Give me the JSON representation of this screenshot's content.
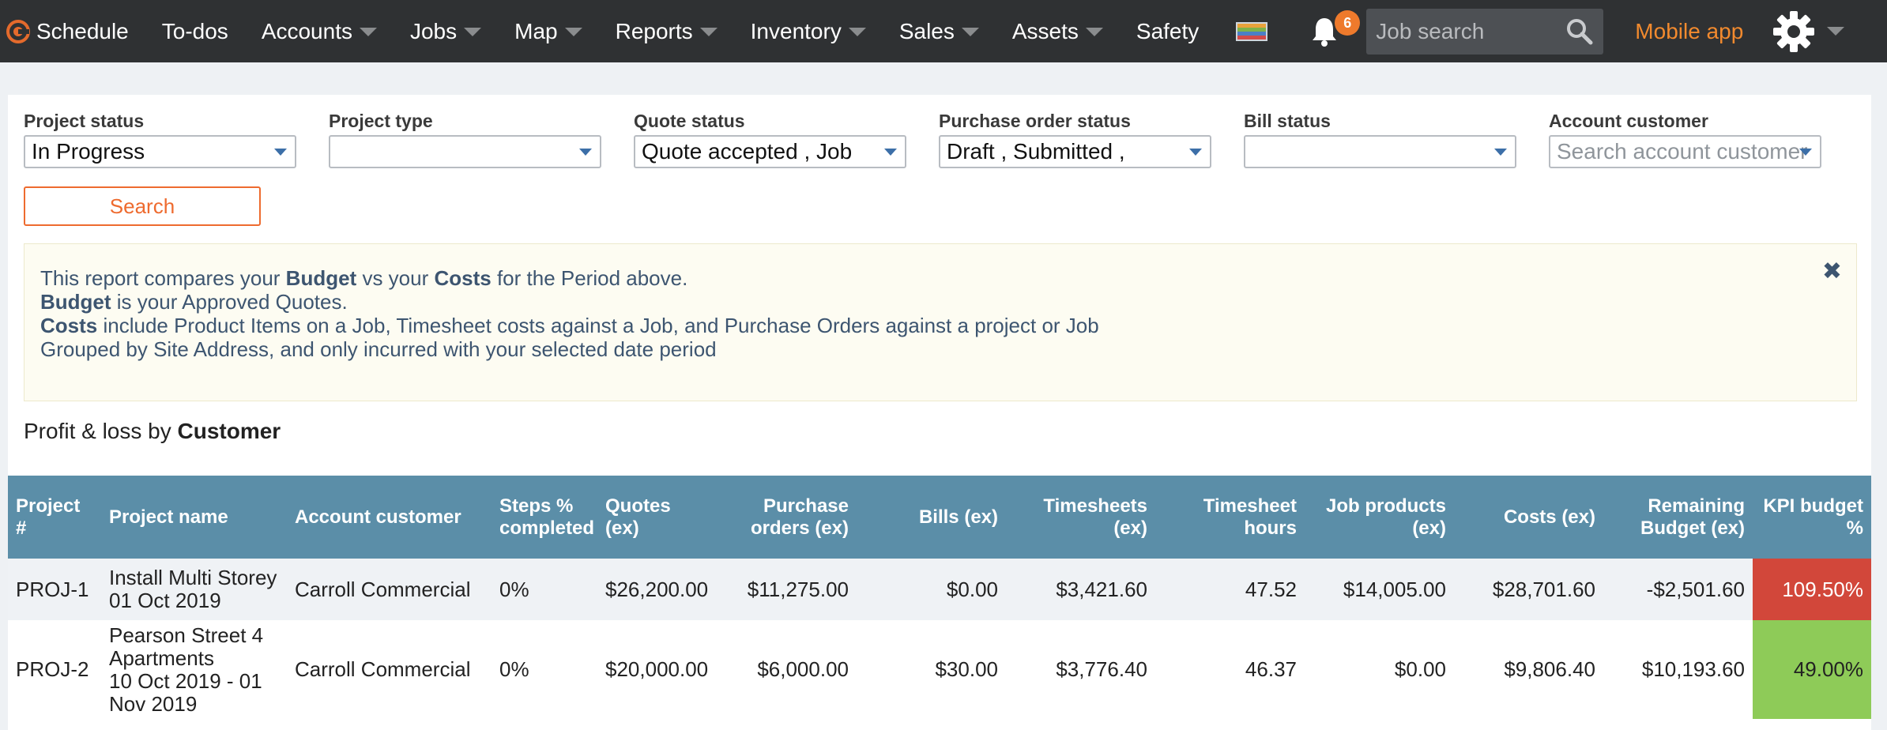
{
  "nav": {
    "logo_label": "Schedule",
    "items": [
      {
        "label": "To-dos",
        "has_caret": false
      },
      {
        "label": "Accounts",
        "has_caret": true
      },
      {
        "label": "Jobs",
        "has_caret": true
      },
      {
        "label": "Map",
        "has_caret": true
      },
      {
        "label": "Reports",
        "has_caret": true
      },
      {
        "label": "Inventory",
        "has_caret": true
      },
      {
        "label": "Sales",
        "has_caret": true
      },
      {
        "label": "Assets",
        "has_caret": true
      },
      {
        "label": "Safety",
        "has_caret": false
      }
    ],
    "notification_count": "6",
    "job_search_placeholder": "Job search",
    "mobile_app_label": "Mobile app",
    "colors": {
      "bar": "#2f3133",
      "accent": "#f28a2e",
      "badge": "#ee7a2c"
    },
    "icons": [
      "logo-icon",
      "flag-icon",
      "bell-icon",
      "search-icon",
      "gear-icon"
    ]
  },
  "filters": {
    "project_status": {
      "label": "Project status",
      "value": "In Progress"
    },
    "project_type": {
      "label": "Project type",
      "value": ""
    },
    "quote_status": {
      "label": "Quote status",
      "value": "Quote accepted , Job"
    },
    "purchase_order_status": {
      "label": "Purchase order status",
      "value": "Draft , Submitted ,"
    },
    "bill_status": {
      "label": "Bill status",
      "value": ""
    },
    "account_customer": {
      "label": "Account customer",
      "placeholder": "Search account customer"
    },
    "search_button": "Search"
  },
  "info": {
    "line1_a": "This report compares your ",
    "line1_b": "Budget",
    "line1_c": " vs your ",
    "line1_d": "Costs",
    "line1_e": " for the Period above.",
    "line2_a": "Budget",
    "line2_b": " is your Approved Quotes.",
    "line3_a": "Costs",
    "line3_b": " include Product Items on a Job, Timesheet costs against a Job, and Purchase Orders against a project or Job",
    "line4": "Grouped by Site Address, and only incurred with your selected date period",
    "close_icon": "✖"
  },
  "report": {
    "title_prefix": "Profit & loss by ",
    "title_bold": "Customer"
  },
  "table": {
    "headers": {
      "project_no": "Project #",
      "project_name": "Project name",
      "account_customer": "Account customer",
      "steps": "Steps % completed",
      "quotes": "Quotes (ex)",
      "purchase_orders": "Purchase orders (ex)",
      "bills": "Bills (ex)",
      "timesheets": "Timesheets (ex)",
      "timesheet_hours": "Timesheet hours",
      "job_products": "Job products (ex)",
      "costs": "Costs (ex)",
      "remaining_budget": "Remaining Budget (ex)",
      "kpi_budget": "KPI budget %"
    },
    "rows": [
      {
        "project_no": "PROJ-1",
        "project_name": "Install Multi Storey\n01 Oct 2019",
        "account_customer": "Carroll Commercial",
        "steps": "0%",
        "quotes": "$26,200.00",
        "purchase_orders": "$11,275.00",
        "bills": "$0.00",
        "timesheets": "$3,421.60",
        "timesheet_hours": "47.52",
        "job_products": "$14,005.00",
        "costs": "$28,701.60",
        "remaining_budget": "-$2,501.60",
        "kpi_budget": "109.50%",
        "kpi_color": "#d2473a"
      },
      {
        "project_no": "PROJ-2",
        "project_name": "Pearson Street 4 Apartments\n10 Oct 2019 - 01 Nov 2019",
        "account_customer": "Carroll Commercial",
        "steps": "0%",
        "quotes": "$20,000.00",
        "purchase_orders": "$6,000.00",
        "bills": "$30.00",
        "timesheets": "$3,776.40",
        "timesheet_hours": "46.37",
        "job_products": "$0.00",
        "costs": "$9,806.40",
        "remaining_budget": "$10,193.60",
        "kpi_budget": "49.00%",
        "kpi_color": "#8ecb58"
      }
    ]
  }
}
